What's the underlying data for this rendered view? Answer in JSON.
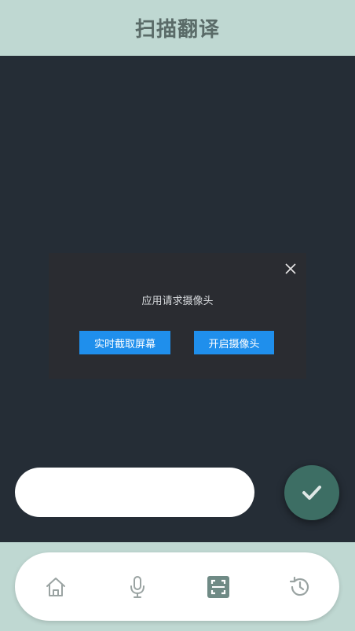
{
  "header": {
    "title": "扫描翻译"
  },
  "dialog": {
    "message": "应用请求摄像头",
    "screenshot_button": "实时截取屏幕",
    "camera_button": "开启摄像头"
  },
  "input": {
    "value": ""
  },
  "nav": {
    "items": [
      "home-icon",
      "microphone-icon",
      "scan-icon",
      "history-icon"
    ],
    "active": "scan-icon"
  },
  "colors": {
    "header_bg": "#bfd8d2",
    "stage_bg": "#252d36",
    "button_blue": "#1f8fec",
    "fab": "#3d6e64",
    "active_icon": "#6f8a85",
    "inactive_icon": "#9aa3a2"
  }
}
